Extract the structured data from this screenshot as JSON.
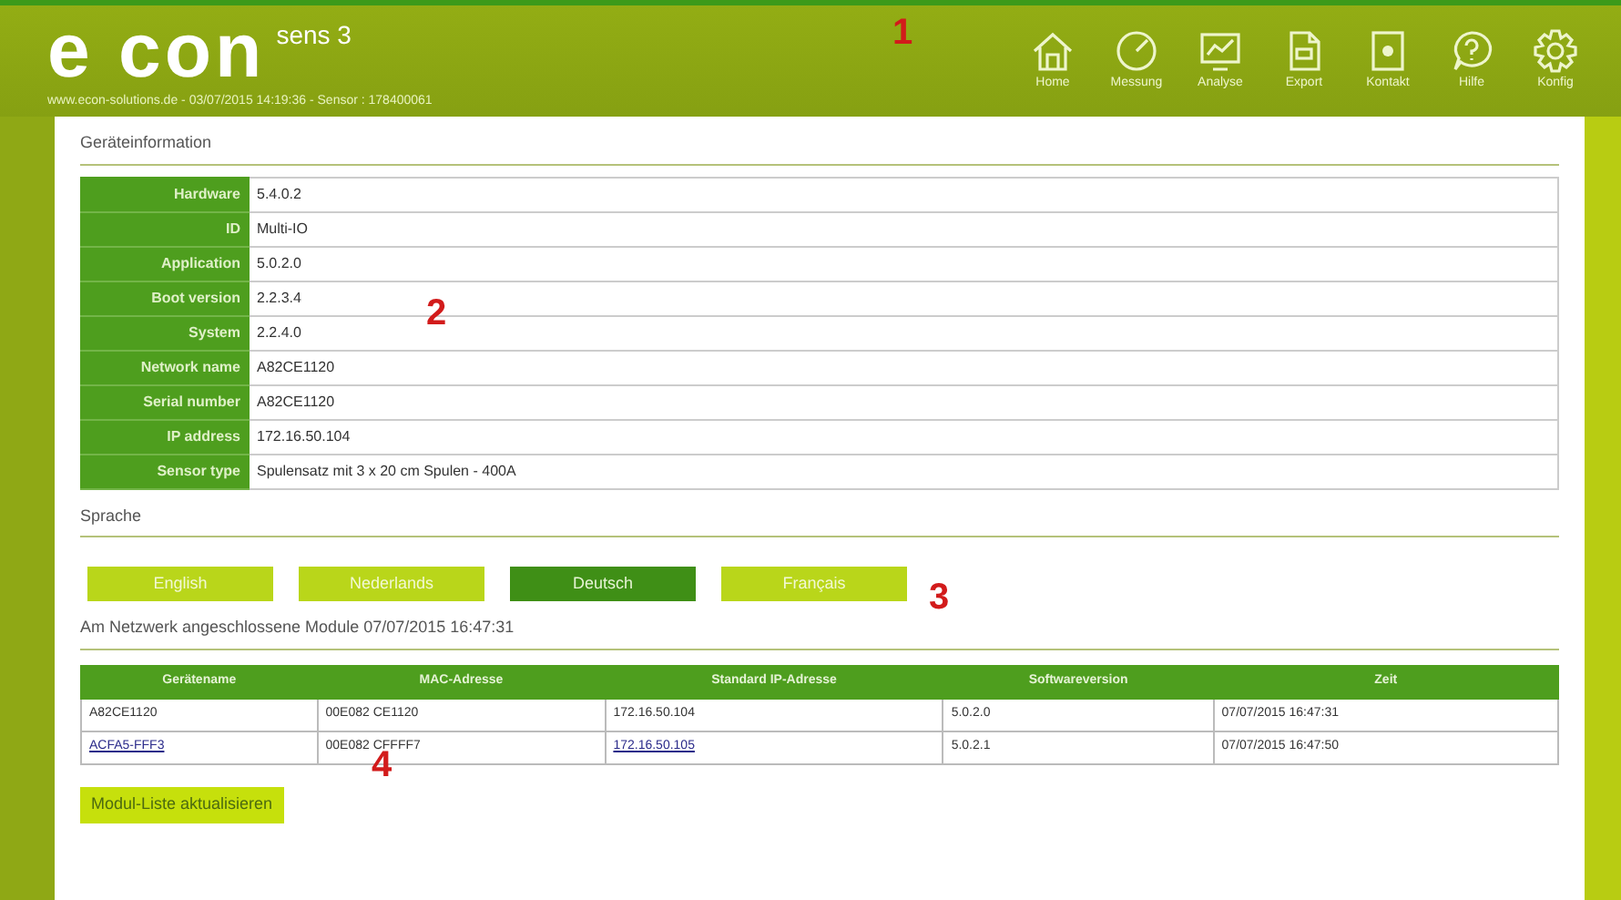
{
  "header": {
    "logo": "e con",
    "logo_suffix": "sens 3",
    "subtitle": "www.econ-solutions.de - 03/07/2015 14:19:36 - Sensor : 178400061",
    "nav": [
      {
        "label": "Home",
        "kind": "home"
      },
      {
        "label": "Messung",
        "kind": "gauge"
      },
      {
        "label": "Analyse",
        "kind": "monitor"
      },
      {
        "label": "Export",
        "kind": "file"
      },
      {
        "label": "Kontakt",
        "kind": "device"
      },
      {
        "label": "Hilfe",
        "kind": "help"
      },
      {
        "label": "Konfig",
        "kind": "gear"
      }
    ]
  },
  "device_info": {
    "title": "Geräteinformation",
    "rows": [
      {
        "label": "Hardware",
        "value": "5.4.0.2"
      },
      {
        "label": "ID",
        "value": "Multi-IO"
      },
      {
        "label": "Application",
        "value": "5.0.2.0"
      },
      {
        "label": "Boot version",
        "value": "2.2.3.4"
      },
      {
        "label": "System",
        "value": "2.2.4.0"
      },
      {
        "label": "Network name",
        "value": "A82CE1120"
      },
      {
        "label": "Serial number",
        "value": "A82CE1120"
      },
      {
        "label": "IP address",
        "value": "172.16.50.104"
      },
      {
        "label": "Sensor type",
        "value": "Spulensatz mit 3 x 20 cm Spulen - 400A"
      }
    ]
  },
  "language": {
    "title": "Sprache",
    "buttons": [
      {
        "label": "English",
        "selected": false
      },
      {
        "label": "Nederlands",
        "selected": false
      },
      {
        "label": "Deutsch",
        "selected": true
      },
      {
        "label": "Français",
        "selected": false
      }
    ]
  },
  "modules": {
    "title": "Am Netzwerk angeschlossene Module 07/07/2015 16:47:31",
    "columns": [
      "Gerätename",
      "MAC-Adresse",
      "Standard IP-Adresse",
      "Softwareversion",
      "Zeit"
    ],
    "rows": [
      {
        "cells": [
          "A82CE1120",
          "00E082 CE1120",
          "172.16.50.104",
          "5.0.2.0",
          "07/07/2015 16:47:31"
        ],
        "link": false
      },
      {
        "cells": [
          "ACFA5-FFF3",
          "00E082 CFFFF7",
          "172.16.50.105",
          "5.0.2.1",
          "07/07/2015 16:47:50"
        ],
        "link": true
      }
    ],
    "action": "Modul-Liste aktualisieren"
  },
  "callouts": [
    "1",
    "2",
    "3",
    "4"
  ]
}
